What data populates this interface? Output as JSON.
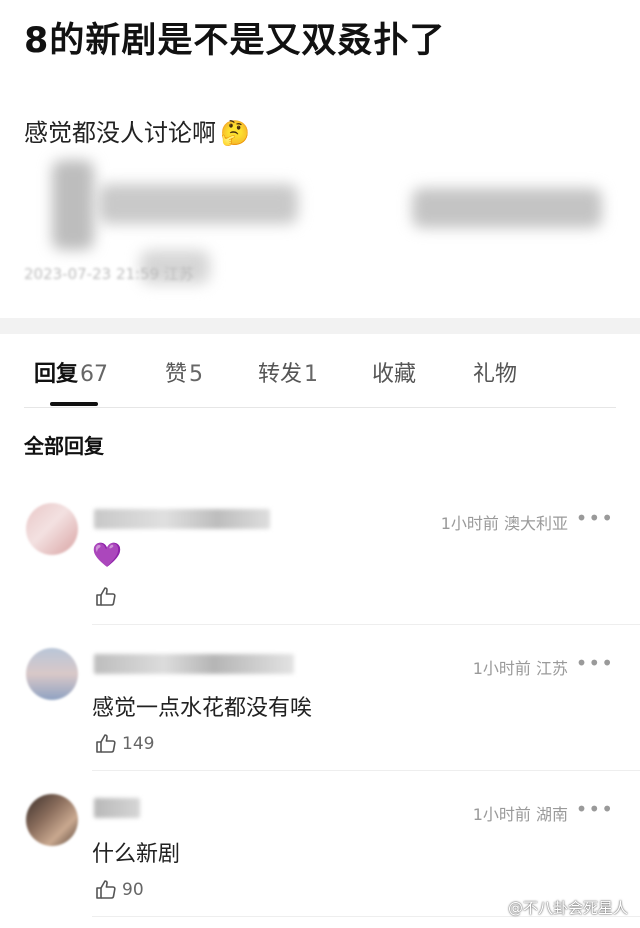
{
  "post": {
    "title": "8的新剧是不是又双叒扑了",
    "body": "感觉都没人讨论啊",
    "emoji": "🤔",
    "meta": "2023-07-23 21:59 江苏"
  },
  "tabs": [
    {
      "label": "回复",
      "count": "67"
    },
    {
      "label": "赞",
      "count": "5"
    },
    {
      "label": "转发",
      "count": "1"
    },
    {
      "label": "收藏",
      "count": ""
    },
    {
      "label": "礼物",
      "count": ""
    }
  ],
  "section_title": "全部回复",
  "comments": [
    {
      "time": "1小时前",
      "location": "澳大利亚",
      "text": "💜",
      "likes": ""
    },
    {
      "time": "1小时前",
      "location": "江苏",
      "text": "感觉一点水花都没有唉",
      "likes": "149"
    },
    {
      "time": "1小时前",
      "location": "湖南",
      "text": "什么新剧",
      "likes": "90"
    }
  ],
  "more_label": "•••",
  "watermark": "@不八卦会死星人"
}
